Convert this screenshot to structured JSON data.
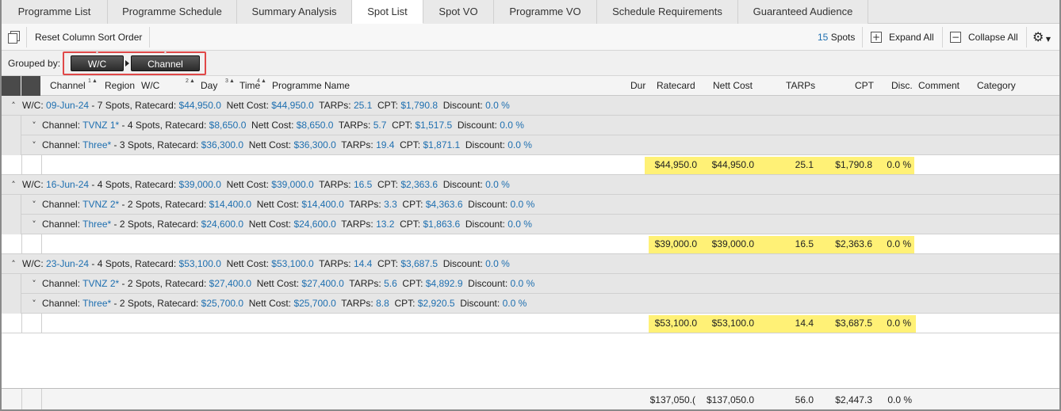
{
  "tabs": [
    {
      "label": "Programme List",
      "active": false
    },
    {
      "label": "Programme Schedule",
      "active": false
    },
    {
      "label": "Summary Analysis",
      "active": false
    },
    {
      "label": "Spot List",
      "active": true
    },
    {
      "label": "Spot VO",
      "active": false
    },
    {
      "label": "Programme VO",
      "active": false
    },
    {
      "label": "Schedule Requirements",
      "active": false
    },
    {
      "label": "Guaranteed Audience",
      "active": false
    }
  ],
  "toolbar": {
    "reset_sort_label": "Reset Column Sort Order",
    "spots_count": "15",
    "spots_label": "Spots",
    "expand_all_label": "Expand All",
    "collapse_all_label": "Collapse All"
  },
  "group_by": {
    "label": "Grouped by:",
    "chips": [
      "W/C",
      "Channel"
    ]
  },
  "columns": {
    "channel": "Channel",
    "channel_sort": "1",
    "region": "Region",
    "wc": "W/C",
    "wc_sort": "2",
    "day": "Day",
    "day_sort": "3",
    "time": "Time",
    "time_sort": "4",
    "programme_name": "Programme Name",
    "dur": "Dur",
    "ratecard": "Ratecard",
    "nett_cost": "Nett Cost",
    "tarps": "TARPs",
    "cpt": "CPT",
    "disc": "Disc.",
    "comment": "Comment",
    "category": "Category"
  },
  "labels": {
    "wc": "W/C:",
    "channel": "Channel:",
    "spots_suffix": "Spots,",
    "ratecard": "Ratecard:",
    "nett_cost": "Nett Cost:",
    "tarps": "TARPs:",
    "cpt": "CPT:",
    "discount": "Discount:"
  },
  "groups": [
    {
      "wc": "09-Jun-24",
      "spots": "7",
      "ratecard": "$44,950.0",
      "nett_cost": "$44,950.0",
      "tarps": "25.1",
      "cpt": "$1,790.8",
      "discount": "0.0 %",
      "channels": [
        {
          "name": "TVNZ 1*",
          "spots": "4",
          "ratecard": "$8,650.0",
          "nett_cost": "$8,650.0",
          "tarps": "5.7",
          "cpt": "$1,517.5",
          "discount": "0.0 %"
        },
        {
          "name": "Three*",
          "spots": "3",
          "ratecard": "$36,300.0",
          "nett_cost": "$36,300.0",
          "tarps": "19.4",
          "cpt": "$1,871.1",
          "discount": "0.0 %"
        }
      ],
      "summary": {
        "ratecard": "$44,950.0",
        "nett_cost": "$44,950.0",
        "tarps": "25.1",
        "cpt": "$1,790.8",
        "disc": "0.0 %"
      }
    },
    {
      "wc": "16-Jun-24",
      "spots": "4",
      "ratecard": "$39,000.0",
      "nett_cost": "$39,000.0",
      "tarps": "16.5",
      "cpt": "$2,363.6",
      "discount": "0.0 %",
      "channels": [
        {
          "name": "TVNZ 2*",
          "spots": "2",
          "ratecard": "$14,400.0",
          "nett_cost": "$14,400.0",
          "tarps": "3.3",
          "cpt": "$4,363.6",
          "discount": "0.0 %"
        },
        {
          "name": "Three*",
          "spots": "2",
          "ratecard": "$24,600.0",
          "nett_cost": "$24,600.0",
          "tarps": "13.2",
          "cpt": "$1,863.6",
          "discount": "0.0 %"
        }
      ],
      "summary": {
        "ratecard": "$39,000.0",
        "nett_cost": "$39,000.0",
        "tarps": "16.5",
        "cpt": "$2,363.6",
        "disc": "0.0 %"
      }
    },
    {
      "wc": "23-Jun-24",
      "spots": "4",
      "ratecard": "$53,100.0",
      "nett_cost": "$53,100.0",
      "tarps": "14.4",
      "cpt": "$3,687.5",
      "discount": "0.0 %",
      "channels": [
        {
          "name": "TVNZ 2*",
          "spots": "2",
          "ratecard": "$27,400.0",
          "nett_cost": "$27,400.0",
          "tarps": "5.6",
          "cpt": "$4,892.9",
          "discount": "0.0 %"
        },
        {
          "name": "Three*",
          "spots": "2",
          "ratecard": "$25,700.0",
          "nett_cost": "$25,700.0",
          "tarps": "8.8",
          "cpt": "$2,920.5",
          "discount": "0.0 %"
        }
      ],
      "summary": {
        "ratecard": "$53,100.0",
        "nett_cost": "$53,100.0",
        "tarps": "14.4",
        "cpt": "$3,687.5",
        "disc": "0.0 %"
      }
    }
  ],
  "totals": {
    "ratecard": "$137,050.(",
    "nett_cost": "$137,050.0",
    "tarps": "56.0",
    "cpt": "$2,447.3",
    "disc": "0.0 %"
  },
  "colors": {
    "value_blue": "#1e6fb0",
    "highlight_yellow": "#fff176",
    "group_outline_red": "#e04848"
  }
}
